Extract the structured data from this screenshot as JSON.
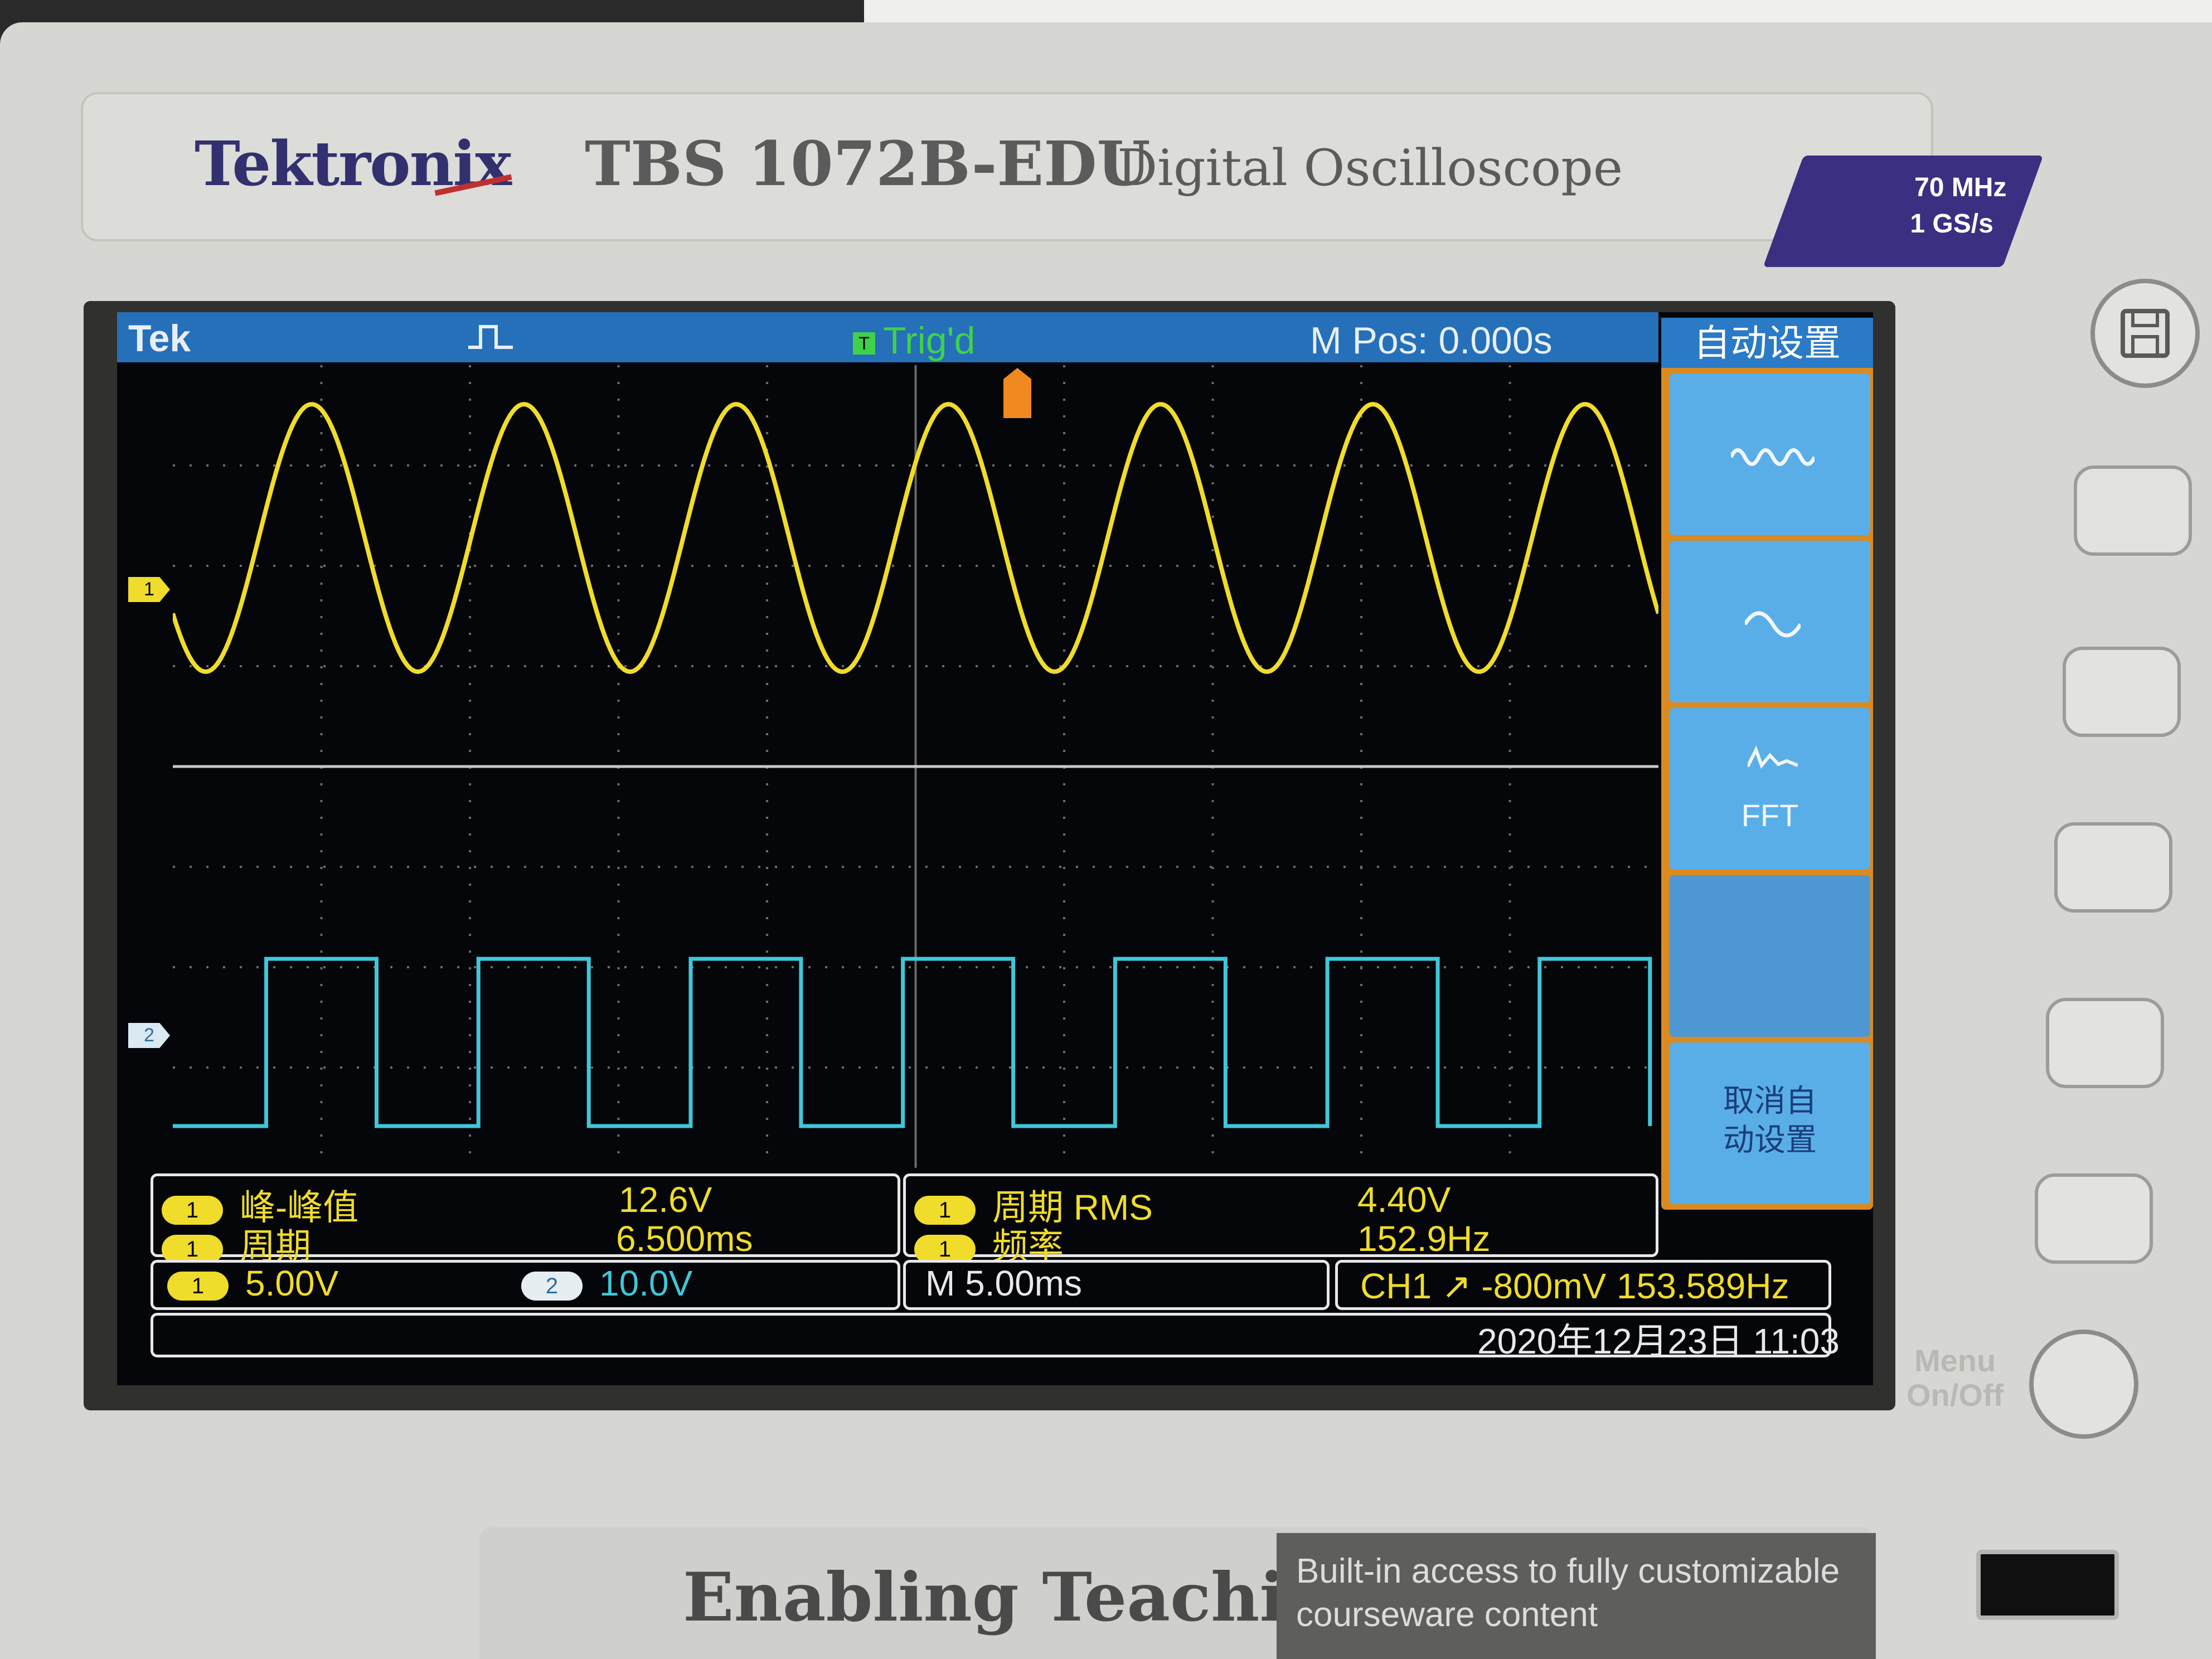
{
  "brand": {
    "logo": "Tektronix",
    "model": "TBS 1072B-EDU",
    "subtitle": "Digital Oscilloscope",
    "spec_bandwidth": "70 MHz",
    "spec_sample_rate": "1 GS/s"
  },
  "status_bar": {
    "tek": "Tek",
    "trig_state": "Trig'd",
    "trig_icon": "T",
    "m_pos": "M Pos: 0.000s",
    "acq_icon": "pulse-icon"
  },
  "channel_markers": {
    "ch1": "1",
    "ch2": "2"
  },
  "menu": {
    "title": "自动设置",
    "items": [
      {
        "name": "multi-cycle",
        "icon": "multi-sine-icon",
        "label": ""
      },
      {
        "name": "single-cycle",
        "icon": "sine-icon",
        "label": ""
      },
      {
        "name": "fft",
        "icon": "fft-icon",
        "label": "FFT"
      },
      {
        "name": "blank",
        "icon": "",
        "label": ""
      },
      {
        "name": "undo-autoset",
        "icon": "",
        "label": "取消自\n动设置"
      }
    ]
  },
  "measurements": {
    "left": [
      {
        "channel": "1",
        "name": "峰-峰值",
        "value": "12.6V"
      },
      {
        "channel": "1",
        "name": "周期",
        "value": "6.500ms"
      }
    ],
    "right": [
      {
        "channel": "1",
        "name": "周期 RMS",
        "value": "4.40V"
      },
      {
        "channel": "1",
        "name": "频率",
        "value": "152.9Hz"
      }
    ]
  },
  "scale_bar": {
    "ch1_label": "1",
    "ch1_scale": "5.00V",
    "ch2_label": "2",
    "ch2_scale": "10.0V",
    "timebase": "M 5.00ms",
    "trigger": "CH1 ↗ -800mV",
    "trigger_freq": "153.589Hz"
  },
  "datetime": "2020年12月23日 11:03",
  "side_label": "Menu\nOn/Off",
  "bottom": {
    "tag": "Enabling Teaching",
    "desc_line1": "Built-in access to fully customizable",
    "desc_line2": "courseware content"
  },
  "colors": {
    "ch1": "#f0dc2a",
    "ch2": "#3fc7d8",
    "status_bar": "#2570b8",
    "menu_button": "#5aaee8",
    "menu_border": "#d98a20"
  },
  "waveforms": {
    "ch1": {
      "shape": "sine",
      "cycles_visible": 7
    },
    "ch2": {
      "shape": "square",
      "cycles_visible": 7
    }
  }
}
